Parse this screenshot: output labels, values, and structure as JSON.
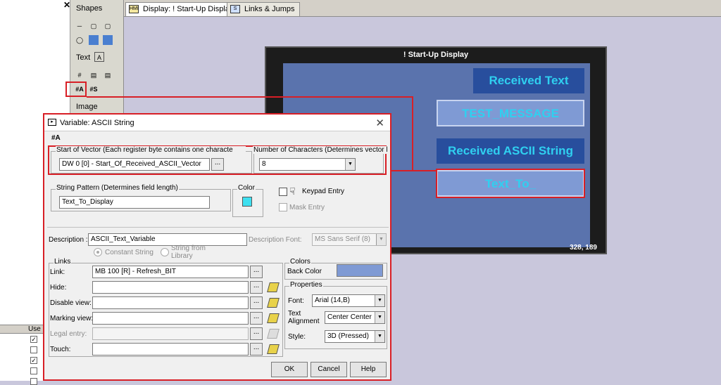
{
  "left_pane": {
    "close_glyph": "✕"
  },
  "palette": {
    "shapes_label": "Shapes",
    "text_label": "Text",
    "image_label": "Image"
  },
  "tabs": [
    {
      "label": "Display: ! Start-Up Display",
      "active": true
    },
    {
      "label": "Links & Jumps",
      "active": false
    }
  ],
  "display": {
    "title": "! Start-Up Display",
    "buttons": [
      {
        "label": "Received Text",
        "bg": "#284e9d",
        "fg": "#2fd0f0"
      },
      {
        "label": "TEST_MESSAGE",
        "bg": "#7f9ad4",
        "fg": "#2fd0f0"
      },
      {
        "label": "Received ASCII String",
        "bg": "#284e9d",
        "fg": "#2fd0f0"
      },
      {
        "label": "Text_To_",
        "bg": "#7f9ad4",
        "fg": "#2fd0f0"
      }
    ],
    "coords": "328, 189"
  },
  "grid": {
    "header": "Use",
    "rows": [
      true,
      false,
      true,
      false,
      false
    ]
  },
  "dialog": {
    "title": "Variable: ASCII String",
    "start_vector": {
      "label": "Start of Vector (Each register byte contains one characte",
      "value": "DW 0 [0] - Start_Of_Received_ASCII_Vector",
      "browse": "..."
    },
    "num_chars": {
      "label": "Number of Characters (Determines vector length",
      "value": "8"
    },
    "string_pattern": {
      "label": "String Pattern (Determines field length)",
      "value": "Text_To_Display"
    },
    "color": {
      "label": "Color",
      "swatch": "#3ee0f0"
    },
    "keypad_entry": "Keypad Entry",
    "mask_entry": "Mask Entry",
    "description": {
      "label": "Description :",
      "value": "ASCII_Text_Variable"
    },
    "description_font": {
      "label": "Description Font:",
      "value": "MS Sans Serif (8)"
    },
    "constant_string": "Constant String",
    "string_from_library": "String from\nLibrary",
    "links": {
      "group": "Links",
      "rows": [
        {
          "label": "Link:",
          "value": "MB 100 [R] - Refresh_BIT",
          "dim": false
        },
        {
          "label": "Hide:",
          "value": "",
          "dim": false
        },
        {
          "label": "Disable view:",
          "value": "",
          "dim": false
        },
        {
          "label": "Marking view:",
          "value": "",
          "dim": false
        },
        {
          "label": "Legal entry:",
          "value": "",
          "dim": true
        },
        {
          "label": "Touch:",
          "value": "",
          "dim": false
        }
      ],
      "browse": "..."
    },
    "colors": {
      "group": "Colors",
      "back_label": "Back Color",
      "back_swatch": "#7f9ad4"
    },
    "properties": {
      "group": "Properties",
      "font_label": "Font:",
      "font_value": "Arial (14,B)",
      "align_label": "Text\nAlignment",
      "align_value": "Center Center",
      "style_label": "Style:",
      "style_value": "3D (Pressed)"
    },
    "buttons": {
      "ok": "OK",
      "cancel": "Cancel",
      "help": "Help"
    }
  },
  "highlight_color": "#d81f26"
}
